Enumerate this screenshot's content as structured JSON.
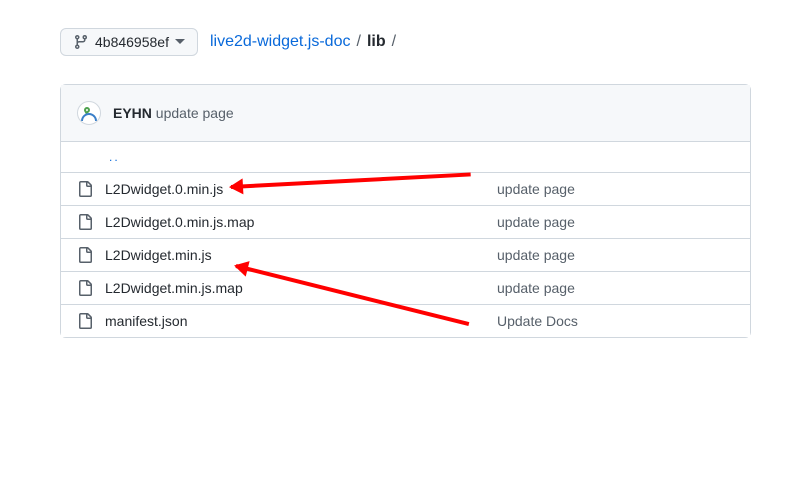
{
  "branch_selector": {
    "ref": "4b846958ef"
  },
  "breadcrumb": {
    "repo": "live2d-widget.js-doc",
    "path": "lib"
  },
  "commit_header": {
    "author": "EYHN",
    "message": "update page"
  },
  "updir": "..",
  "files": [
    {
      "name": "L2Dwidget.0.min.js",
      "msg": "update page"
    },
    {
      "name": "L2Dwidget.0.min.js.map",
      "msg": "update page"
    },
    {
      "name": "L2Dwidget.min.js",
      "msg": "update page"
    },
    {
      "name": "L2Dwidget.min.js.map",
      "msg": "update page"
    },
    {
      "name": "manifest.json",
      "msg": "Update Docs"
    }
  ]
}
